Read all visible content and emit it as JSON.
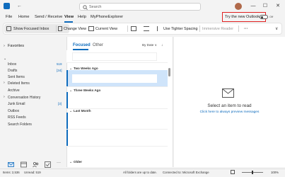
{
  "window": {
    "minimize": "—",
    "maximize": "☐",
    "close": "✕"
  },
  "search": {
    "placeholder": "Search"
  },
  "menu": {
    "tabs": [
      "File",
      "Home",
      "Send / Receive",
      "View",
      "Help",
      "MyPhoneExplorer"
    ],
    "try_new": "Try the new Outlook",
    "toggle_state": "Off"
  },
  "ribbon": {
    "show_focused": "Show Focused Inbox",
    "change_view": "Change View",
    "current_view": "Current View",
    "tighter_spacing": "Use Tighter Spacing",
    "immersive_reader": "Immersive Reader",
    "more": "···"
  },
  "folders": {
    "favorites": "Favorites",
    "items": [
      {
        "label": "Inbox",
        "count": "519"
      },
      {
        "label": "Drafts",
        "count": "[34]"
      },
      {
        "label": "Sent Items",
        "count": ""
      },
      {
        "label": "Deleted Items",
        "count": ""
      },
      {
        "label": "Archive",
        "count": ""
      },
      {
        "label": "Conversation History",
        "count": ""
      },
      {
        "label": "Junk Email",
        "count": "[3]"
      },
      {
        "label": "Outbox",
        "count": ""
      },
      {
        "label": "RSS Feeds",
        "count": ""
      },
      {
        "label": "Search Folders",
        "count": ""
      }
    ]
  },
  "list": {
    "tab_focused": "Focused",
    "tab_other": "Other",
    "sort": "By Date ∨",
    "groups": [
      "Two Weeks Ago",
      "Three Weeks Ago",
      "Last Month",
      "Older"
    ]
  },
  "reading": {
    "title": "Select an item to read",
    "link": "Click here to always preview messages"
  },
  "status": {
    "items": "Items: 2,536",
    "unread": "Unread: 519",
    "folders_up_to_date": "All folders are up to date.",
    "connected": "Connected to: Microsoft Exchange",
    "zoom": "100%"
  },
  "colors": {
    "accent": "#0f6cbd",
    "highlight_border": "#e02020",
    "selected_row": "#cfe4fa"
  }
}
